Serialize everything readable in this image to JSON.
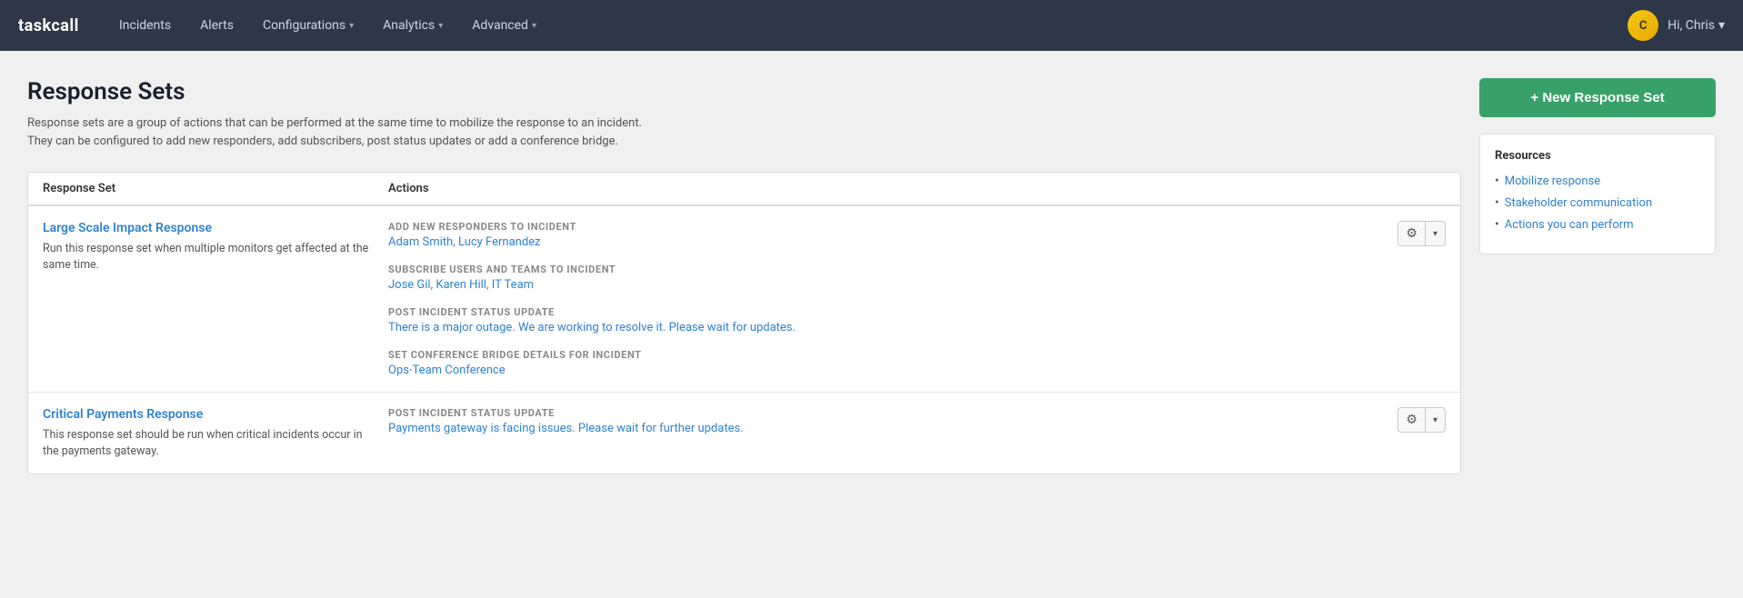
{
  "app": {
    "brand": "taskcall"
  },
  "navbar": {
    "links": [
      {
        "id": "incidents",
        "label": "Incidents",
        "hasDropdown": false
      },
      {
        "id": "alerts",
        "label": "Alerts",
        "hasDropdown": false
      },
      {
        "id": "configurations",
        "label": "Configurations",
        "hasDropdown": true
      },
      {
        "id": "analytics",
        "label": "Analytics",
        "hasDropdown": true
      },
      {
        "id": "advanced",
        "label": "Advanced",
        "hasDropdown": true
      }
    ],
    "user": {
      "greeting": "Hi, Chris",
      "avatar_initials": "C"
    }
  },
  "page": {
    "title": "Response Sets",
    "description": "Response sets are a group of actions that can be performed at the same time to mobilize the response to an incident. They can be configured to add new responders, add subscribers, post status updates or add a conference bridge.",
    "table": {
      "col1": "Response Set",
      "col2": "Actions"
    },
    "new_button": "+ New Response Set",
    "rows": [
      {
        "id": "row-1",
        "name": "Large Scale Impact Response",
        "description": "Run this response set when multiple monitors get affected at the same time.",
        "action_blocks": [
          {
            "label": "ADD NEW RESPONDERS TO INCIDENT",
            "value": "Adam Smith, Lucy Fernandez"
          },
          {
            "label": "SUBSCRIBE USERS AND TEAMS TO INCIDENT",
            "value": "Jose Gil, Karen Hill, IT Team"
          },
          {
            "label": "POST INCIDENT STATUS UPDATE",
            "value": "There is a major outage. We are working to resolve it. Please wait for updates."
          },
          {
            "label": "SET CONFERENCE BRIDGE DETAILS FOR INCIDENT",
            "value": "Ops-Team Conference"
          }
        ]
      },
      {
        "id": "row-2",
        "name": "Critical Payments Response",
        "description": "This response set should be run when critical incidents occur in the payments gateway.",
        "action_blocks": [
          {
            "label": "POST INCIDENT STATUS UPDATE",
            "value": "Payments gateway is facing issues. Please wait for further updates."
          }
        ]
      }
    ],
    "resources": {
      "title": "Resources",
      "links": [
        "Mobilize response",
        "Stakeholder communication",
        "Actions you can perform"
      ]
    }
  }
}
